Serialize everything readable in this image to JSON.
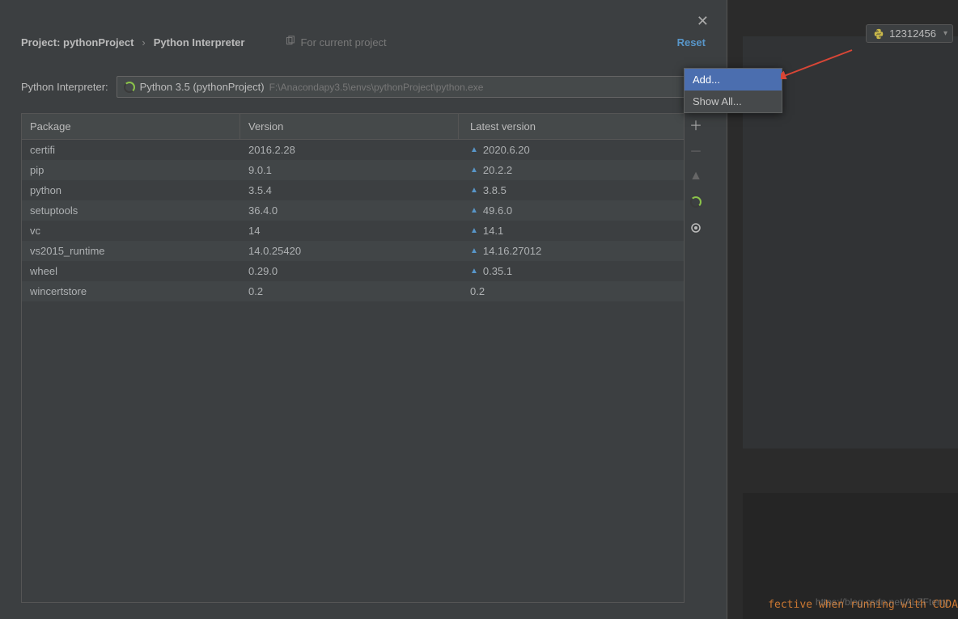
{
  "topbar": {
    "interpreter_badge": "12312456"
  },
  "dialog": {
    "breadcrumb_project": "Project: pythonProject",
    "breadcrumb_page": "Python Interpreter",
    "for_current": "For current project",
    "reset": "Reset",
    "interpreter_label": "Python Interpreter:",
    "interpreter_name": "Python 3.5 (pythonProject)",
    "interpreter_path": "F:\\Anacondapy3.5\\envs\\pythonProject\\python.exe"
  },
  "popup": {
    "add": "Add...",
    "show_all": "Show All..."
  },
  "columns": {
    "package": "Package",
    "version": "Version",
    "latest": "Latest version"
  },
  "packages": [
    {
      "name": "certifi",
      "version": "2016.2.28",
      "latest": "2020.6.20",
      "upgradable": true
    },
    {
      "name": "pip",
      "version": "9.0.1",
      "latest": "20.2.2",
      "upgradable": true
    },
    {
      "name": "python",
      "version": "3.5.4",
      "latest": "3.8.5",
      "upgradable": true
    },
    {
      "name": "setuptools",
      "version": "36.4.0",
      "latest": "49.6.0",
      "upgradable": true
    },
    {
      "name": "vc",
      "version": "14",
      "latest": "14.1",
      "upgradable": true
    },
    {
      "name": "vs2015_runtime",
      "version": "14.0.25420",
      "latest": "14.16.27012",
      "upgradable": true
    },
    {
      "name": "wheel",
      "version": "0.29.0",
      "latest": "0.35.1",
      "upgradable": true
    },
    {
      "name": "wincertstore",
      "version": "0.2",
      "latest": "0.2",
      "upgradable": false
    }
  ],
  "watermark": "https://blog.csdn.net/ALZFterry",
  "bottom_code": "fective when running with CUDA"
}
